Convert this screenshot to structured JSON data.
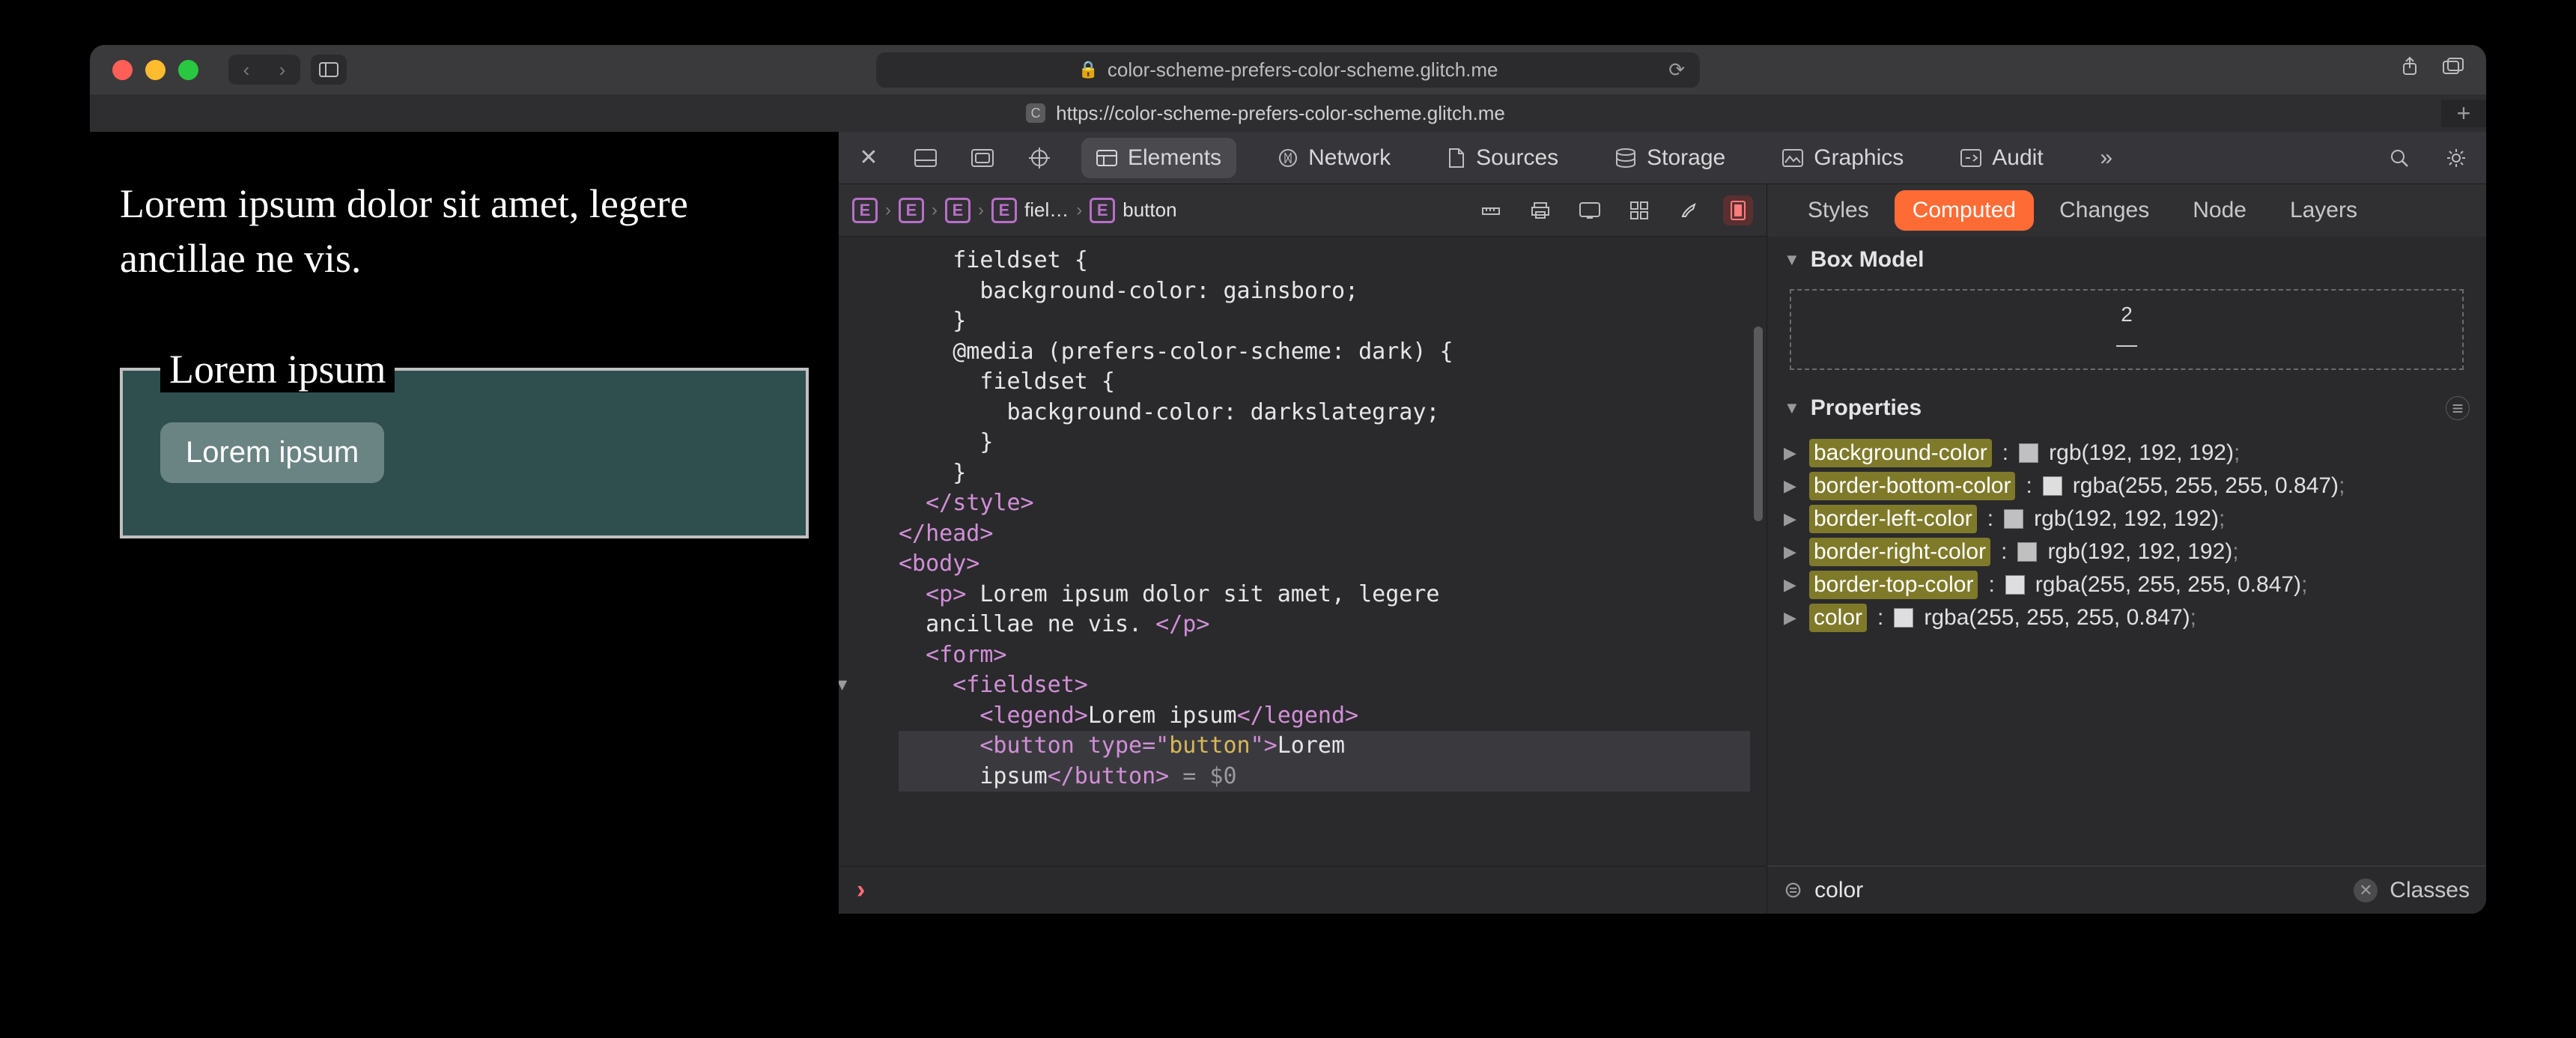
{
  "titlebar": {
    "url_host": "color-scheme-prefers-color-scheme.glitch.me",
    "tab_url": "https://color-scheme-prefers-color-scheme.glitch.me",
    "favicon_letter": "C"
  },
  "preview": {
    "paragraph": "Lorem ipsum dolor sit amet, legere ancillae ne vis.",
    "legend": "Lorem ipsum",
    "button": "Lorem ipsum"
  },
  "devtools": {
    "tabs": {
      "elements": "Elements",
      "network": "Network",
      "sources": "Sources",
      "storage": "Storage",
      "graphics": "Graphics",
      "audit": "Audit"
    },
    "breadcrumb": {
      "item3": "fiel…",
      "item4": "button"
    },
    "source": {
      "l1": "    fieldset {",
      "l2": "      background-color: gainsboro;",
      "l3": "    }",
      "l4": "    @media (prefers-color-scheme: dark) {",
      "l5": "      fieldset {",
      "l6": "        background-color: darkslategray;",
      "l7": "      }",
      "l8": "    }",
      "l9": "  </style>",
      "l10": "</head>",
      "l11": "<body>",
      "l12a": "  <p>",
      "l12b": " Lorem ipsum dolor sit amet, legere",
      "l13": "  ancillae ne vis. ",
      "l13b": "</p>",
      "l14": "  <form>",
      "l15": "    <fieldset>",
      "l16a": "      <legend>",
      "l16b": "Lorem ipsum",
      "l16c": "</legend>",
      "l17a": "      <button ",
      "l17b": "type",
      "l17c": "=\"",
      "l17d": "button",
      "l17e": "\">",
      "l17f": "Lorem",
      "l18a": "      ipsum",
      "l18b": "</button>",
      "l18c": " = $0"
    },
    "right_tabs": {
      "styles": "Styles",
      "computed": "Computed",
      "changes": "Changes",
      "node": "Node",
      "layers": "Layers"
    },
    "boxmodel": {
      "title": "Box Model",
      "top": "2",
      "bottom": "—"
    },
    "properties": {
      "title": "Properties",
      "rows": [
        {
          "name": "background-color",
          "swatch": "rgb(192,192,192)",
          "value": "rgb(192, 192, 192)"
        },
        {
          "name": "border-bottom-color",
          "swatch": "rgba(255,255,255,0.847)",
          "value": "rgba(255, 255, 255, 0.847)"
        },
        {
          "name": "border-left-color",
          "swatch": "rgb(192,192,192)",
          "value": "rgb(192, 192, 192)"
        },
        {
          "name": "border-right-color",
          "swatch": "rgb(192,192,192)",
          "value": "rgb(192, 192, 192)"
        },
        {
          "name": "border-top-color",
          "swatch": "rgba(255,255,255,0.847)",
          "value": "rgba(255, 255, 255, 0.847)"
        },
        {
          "name": "color",
          "swatch": "rgba(255,255,255,0.847)",
          "value": "rgba(255, 255, 255, 0.847)"
        }
      ],
      "filter_value": "color",
      "classes_label": "Classes"
    }
  }
}
